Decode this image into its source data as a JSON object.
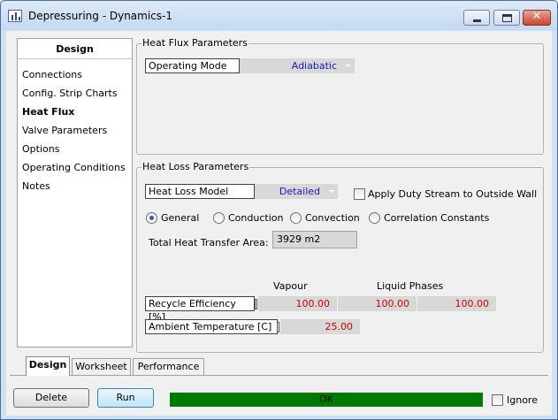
{
  "window": {
    "title": "Depressuring - Dynamics-1"
  },
  "nav": {
    "header": "Design",
    "items": [
      {
        "label": "Connections"
      },
      {
        "label": "Config. Strip Charts"
      },
      {
        "label": "Heat Flux"
      },
      {
        "label": "Valve Parameters"
      },
      {
        "label": "Options"
      },
      {
        "label": "Operating Conditions"
      },
      {
        "label": "Notes"
      }
    ],
    "selected": "Heat Flux"
  },
  "heat_flux": {
    "title": "Heat Flux Parameters",
    "operating_mode_label": "Operating Mode",
    "operating_mode_value": "Adiabatic"
  },
  "heat_loss": {
    "title": "Heat Loss Parameters",
    "model_label": "Heat Loss Model",
    "model_value": "Detailed",
    "apply_duty_label": "Apply Duty Stream to Outside Wall",
    "apply_duty_checked": false,
    "radio_options": [
      "General",
      "Conduction",
      "Convection",
      "Correlation Constants"
    ],
    "radio_selected": "General",
    "area_label": "Total Heat Transfer Area:",
    "area_value": "3929 m2",
    "col_vapour": "Vapour",
    "col_liquid": "Liquid Phases",
    "recycle_label": "Recycle Efficiency [%]",
    "recycle_values": [
      "100.00",
      "100.00",
      "100.00"
    ],
    "ambient_label": "Ambient Temperature [C]",
    "ambient_value": "25.00"
  },
  "tabs": [
    {
      "label": "Design"
    },
    {
      "label": "Worksheet"
    },
    {
      "label": "Performance"
    }
  ],
  "active_tab": "Design",
  "footer": {
    "delete_label": "Delete",
    "run_label": "Run",
    "status_text": "OK",
    "ignore_label": "Ignore",
    "ignore_checked": false
  },
  "colors": {
    "status_ok": "#007a00",
    "combo_text": "#1a1acc",
    "value_text": "#d00000"
  }
}
